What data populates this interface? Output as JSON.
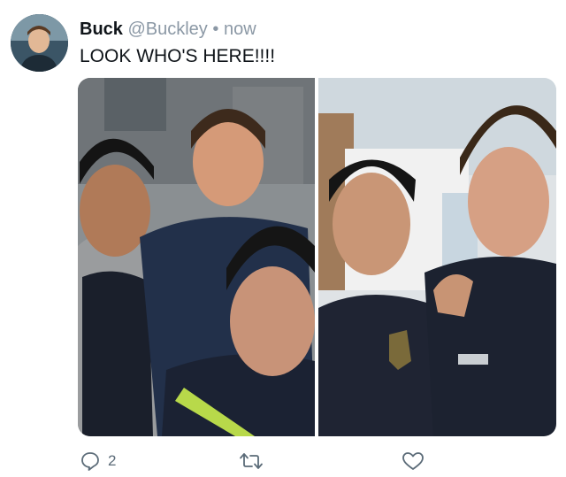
{
  "tweet": {
    "display_name": "Buck",
    "handle": "@Buckley",
    "separator": "•",
    "time": "now",
    "text": "LOOK WHO'S HERE!!!!"
  },
  "media": {
    "count": 2
  },
  "actions": {
    "reply_count": "2",
    "reply_icon": "speech-bubble-icon",
    "retweet_icon": "retweet-arrows-icon",
    "like_icon": "heart-outline-icon"
  },
  "colors": {
    "text_primary": "#0f1419",
    "text_secondary": "#8b98a5",
    "action_icon": "#5b6b78",
    "background": "#ffffff"
  }
}
